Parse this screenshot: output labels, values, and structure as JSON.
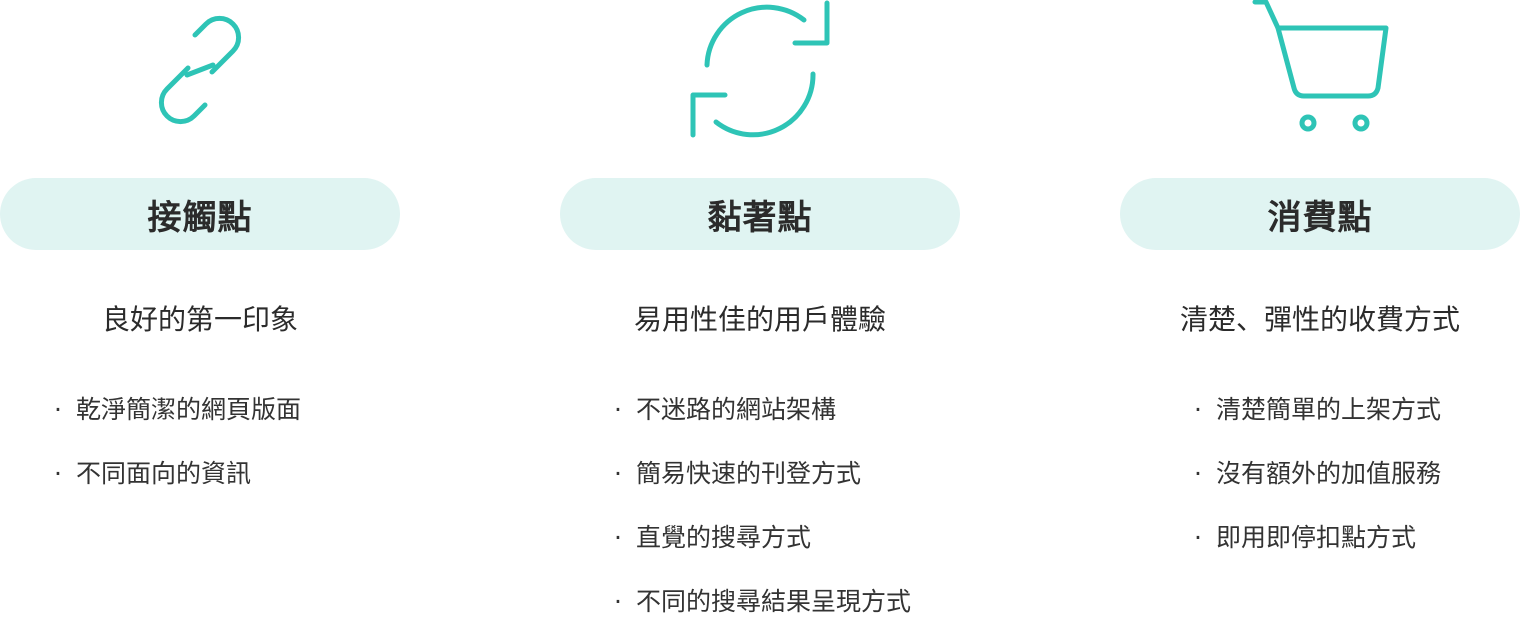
{
  "colors": {
    "accent": "#2ec4b6",
    "pill_background": "#e0f4f2",
    "text": "#2b2b2b"
  },
  "columns": [
    {
      "icon": "link-icon",
      "title": "接觸點",
      "subtitle": "良好的第一印象",
      "bullet_marker": "·",
      "bullets": [
        "乾淨簡潔的網頁版面",
        "不同面向的資訊"
      ]
    },
    {
      "icon": "refresh-icon",
      "title": "黏著點",
      "subtitle": "易用性佳的用戶體驗",
      "bullet_marker": "·",
      "bullets": [
        "不迷路的網站架構",
        "簡易快速的刊登方式",
        "直覺的搜尋方式",
        "不同的搜尋結果呈現方式"
      ]
    },
    {
      "icon": "shopping-cart-icon",
      "title": "消費點",
      "subtitle": "清楚、彈性的收費方式",
      "bullet_marker": "·",
      "bullets": [
        "清楚簡單的上架方式",
        "沒有額外的加值服務",
        "即用即停扣點方式"
      ]
    }
  ]
}
